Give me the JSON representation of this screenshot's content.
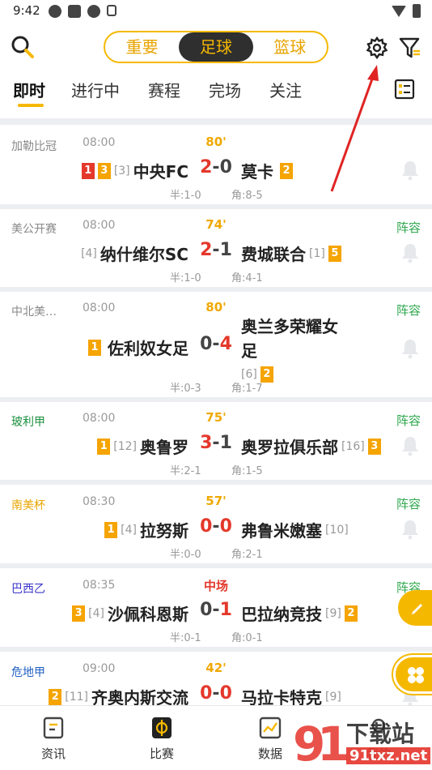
{
  "status_bar": {
    "time": "9:42"
  },
  "top_segments": [
    {
      "label": "重要",
      "active": false
    },
    {
      "label": "足球",
      "active": true
    },
    {
      "label": "篮球",
      "active": false
    }
  ],
  "tabs": [
    "即时",
    "进行中",
    "赛程",
    "完场",
    "关注"
  ],
  "matches": [
    {
      "league": "加勒比冠",
      "league_color": "#888888",
      "time": "08:00",
      "minute": "80'",
      "minute_color": "#f0a800",
      "lineup": "",
      "home_badges": [
        {
          "t": "1",
          "c": "r"
        },
        {
          "t": "3",
          "c": "y"
        }
      ],
      "home_rank": "[3]",
      "home": "中央FC",
      "score_home": "2",
      "score_away": "0",
      "score_hl": "home",
      "away": "莫卡",
      "away_rank": "",
      "away_badges": [
        {
          "t": "2",
          "c": "y"
        }
      ],
      "half": "半:1-0",
      "corner": "角:8-5"
    },
    {
      "league": "美公开赛",
      "league_color": "#888888",
      "time": "08:00",
      "minute": "74'",
      "minute_color": "#f0a800",
      "lineup": "阵容",
      "home_badges": [],
      "home_rank": "[4]",
      "home": "纳什维尔SC",
      "score_home": "2",
      "score_away": "1",
      "score_hl": "home",
      "away": "费城联合",
      "away_rank": "[1]",
      "away_badges": [
        {
          "t": "5",
          "c": "y"
        }
      ],
      "half": "半:1-0",
      "corner": "角:4-1"
    },
    {
      "league": "中北美…",
      "league_color": "#888888",
      "time": "08:00",
      "minute": "80'",
      "minute_color": "#f0a800",
      "lineup": "阵容",
      "home_badges": [
        {
          "t": "1",
          "c": "y"
        }
      ],
      "home_rank": "",
      "home": "佐利奴女足",
      "score_home": "0",
      "score_away": "4",
      "score_hl": "away",
      "away": "奥兰多荣耀女足",
      "away_rank": "[6]",
      "away_badges": [
        {
          "t": "2",
          "c": "y"
        }
      ],
      "half": "半:0-3",
      "corner": "角:1-7"
    },
    {
      "league": "玻利甲",
      "league_color": "#1a8f3c",
      "time": "08:00",
      "minute": "75'",
      "minute_color": "#f0a800",
      "lineup": "阵容",
      "home_badges": [
        {
          "t": "1",
          "c": "y"
        }
      ],
      "home_rank": "[12]",
      "home": "奥鲁罗",
      "score_home": "3",
      "score_away": "1",
      "score_hl": "home",
      "away": "奥罗拉俱乐部",
      "away_rank": "[16]",
      "away_badges": [
        {
          "t": "3",
          "c": "y"
        }
      ],
      "half": "半:2-1",
      "corner": "角:1-5"
    },
    {
      "league": "南美杯",
      "league_color": "#e8a400",
      "time": "08:30",
      "minute": "57'",
      "minute_color": "#f0a800",
      "lineup": "阵容",
      "home_badges": [
        {
          "t": "1",
          "c": "y"
        }
      ],
      "home_rank": "[4]",
      "home": "拉努斯",
      "score_home": "0",
      "score_away": "0",
      "score_hl": "both",
      "away": "弗鲁米嫩塞",
      "away_rank": "[10]",
      "away_badges": [],
      "half": "半:0-0",
      "corner": "角:2-1"
    },
    {
      "league": "巴西乙",
      "league_color": "#3b35c9",
      "time": "08:35",
      "minute": "中场",
      "minute_color": "#e4382b",
      "lineup": "阵容",
      "home_badges": [
        {
          "t": "3",
          "c": "y"
        }
      ],
      "home_rank": "[4]",
      "home": "沙佩科恩斯",
      "score_home": "0",
      "score_away": "1",
      "score_hl": "away",
      "away": "巴拉纳竞技",
      "away_rank": "[9]",
      "away_badges": [
        {
          "t": "2",
          "c": "y"
        }
      ],
      "half": "半:0-1",
      "corner": "角:0-1"
    },
    {
      "league": "危地甲",
      "league_color": "#1f5fc4",
      "time": "09:00",
      "minute": "42'",
      "minute_color": "#f0a800",
      "lineup": "",
      "home_badges": [
        {
          "t": "2",
          "c": "y"
        }
      ],
      "home_rank": "[11]",
      "home": "齐奥内斯交流",
      "score_home": "0",
      "score_away": "0",
      "score_hl": "both",
      "away": "马拉卡特克",
      "away_rank": "[9]",
      "away_badges": [],
      "half": "",
      "corner": ""
    }
  ],
  "bottom_nav": [
    {
      "label": "资讯",
      "icon": "news-icon"
    },
    {
      "label": "比赛",
      "icon": "match-icon"
    },
    {
      "label": "数据",
      "icon": "data-icon"
    },
    {
      "label": "我的",
      "icon": "profile-icon"
    }
  ],
  "watermark": {
    "big": "下载站",
    "small": "91txz.net"
  }
}
